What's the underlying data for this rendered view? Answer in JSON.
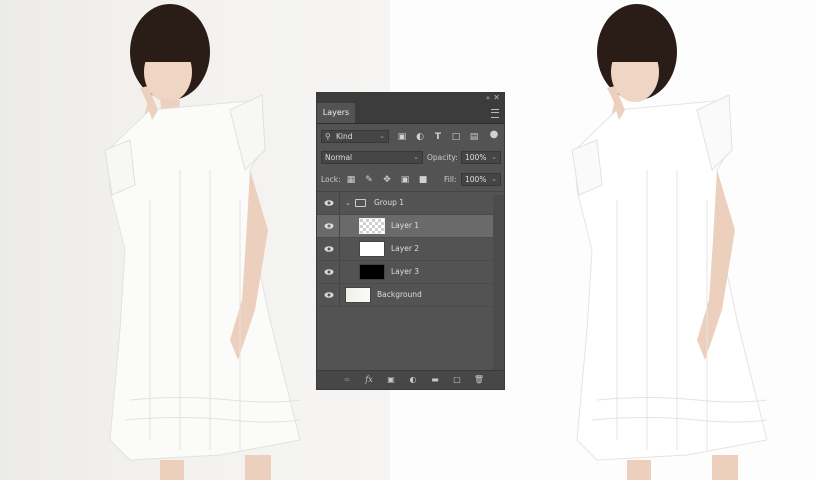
{
  "panel": {
    "tab_label": "Layers",
    "filter": {
      "value": "Kind"
    },
    "blend_mode": {
      "value": "Normal"
    },
    "opacity": {
      "label": "Opacity:",
      "value": "100%"
    },
    "lock": {
      "label": "Lock:"
    },
    "fill": {
      "label": "Fill:",
      "value": "100%"
    }
  },
  "layers": [
    {
      "name": "Group 1",
      "type": "group",
      "selected": false
    },
    {
      "name": "Layer 1",
      "type": "transparent",
      "selected": true
    },
    {
      "name": "Layer 2",
      "type": "white",
      "selected": false
    },
    {
      "name": "Layer 3",
      "type": "black",
      "selected": false
    },
    {
      "name": "Background",
      "type": "background",
      "selected": false
    }
  ],
  "colors": {
    "panel_bg": "#535353",
    "panel_dark": "#3c3c3c",
    "selected_row": "#6a6a6a"
  }
}
